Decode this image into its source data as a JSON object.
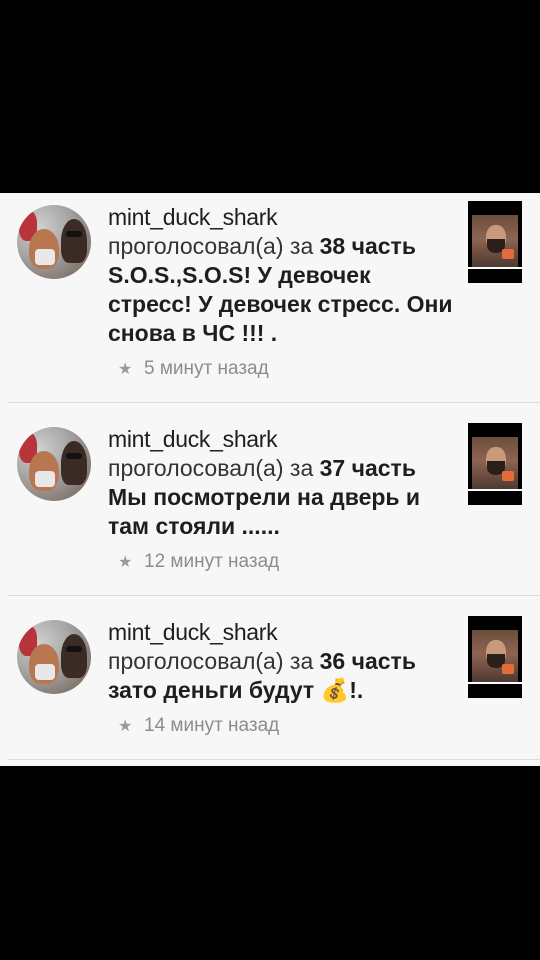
{
  "feed": {
    "items": [
      {
        "username": "mint_duck_shark",
        "action": "проголосовал(а) за",
        "part": "38 часть",
        "title": "S.O.S.,S.O.S! У девочек стресс! У девочек стресс. Они снова в ЧС !!! .",
        "time": "5 минут назад"
      },
      {
        "username": "mint_duck_shark",
        "action": "проголосовал(а) за",
        "part": "37 часть",
        "title": "Мы посмотрели на дверь и там стояли ......",
        "time": "12 минут назад"
      },
      {
        "username": "mint_duck_shark",
        "action": "проголосовал(а) за",
        "part": "36 часть",
        "title": "зато деньги будут",
        "title_icon": "money-bag-icon",
        "title_end": "!.",
        "time": "14 минут назад"
      }
    ]
  }
}
